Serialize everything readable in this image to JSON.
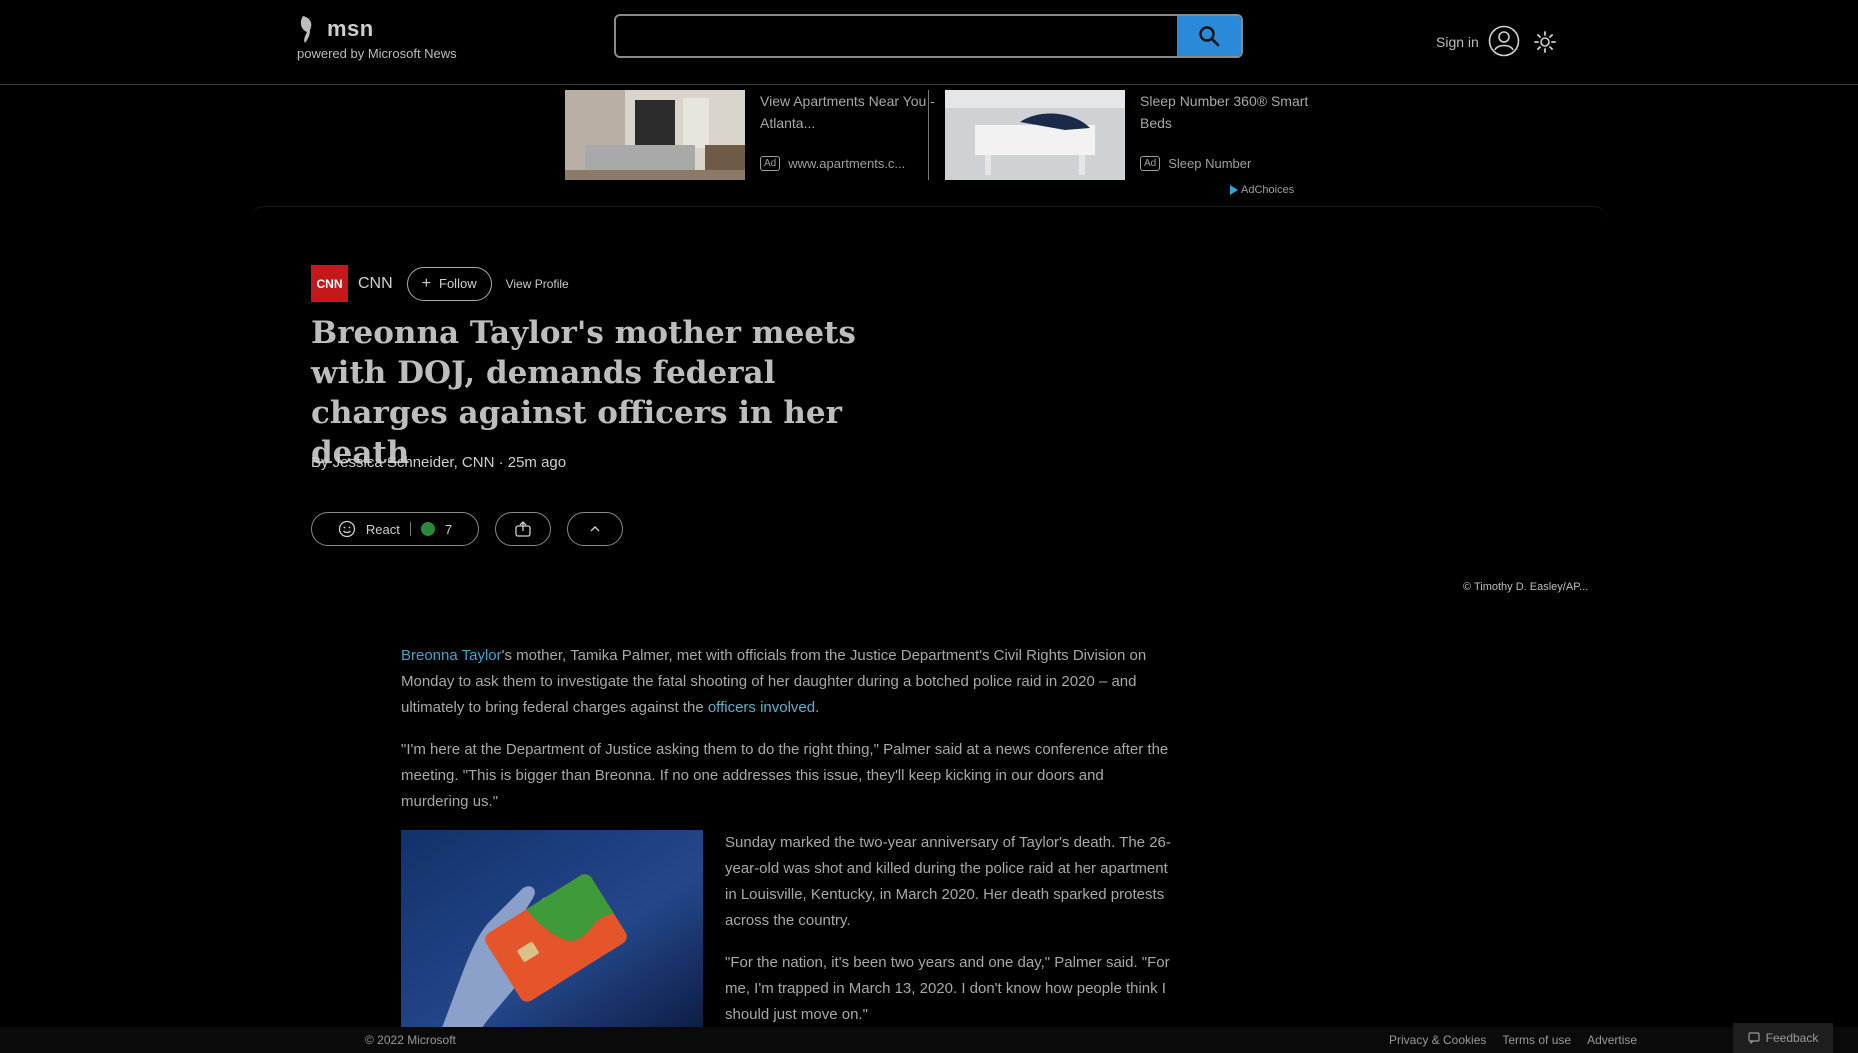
{
  "header": {
    "logo_word": "msn",
    "powered_by": "powered by Microsoft News",
    "search_placeholder": "",
    "sign_in": "Sign in"
  },
  "ads": [
    {
      "title": "View Apartments Near You - Atlanta...",
      "badge": "Ad",
      "source": "www.apartments.c..."
    },
    {
      "title": "Sleep Number 360® Smart Beds",
      "badge": "Ad",
      "source": "Sleep Number"
    }
  ],
  "adchoices": "AdChoices",
  "article": {
    "source_logo": "CNN",
    "source_name": "CNN",
    "follow_label": "Follow",
    "view_profile": "View Profile",
    "headline": "Breonna Taylor's mother meets with DOJ, demands federal charges against officers in her death",
    "byline": "By Jessica Schneider, CNN · 25m ago",
    "react_label": "React",
    "react_count": "7",
    "photo_credit": "© Timothy D. Easley/AP...",
    "p1_link": "Breonna Taylor",
    "p1_text": "'s mother, Tamika Palmer, met with officials from the Justice Department's Civil Rights Division on Monday to ask them to investigate the fatal shooting of her daughter during a botched police raid in 2020 – and ultimately to bring federal charges against the ",
    "p1_link2": "officers involved",
    "p1_end": ".",
    "p2": "\"I'm here at the Department of Justice asking them to do the right thing,\" Palmer said at a news conference after the meeting. \"This is bigger than Breonna. If no one addresses this issue, they'll keep kicking in our doors and murdering us.\"",
    "p3": "Sunday marked the two-year anniversary of Taylor's death. The 26-year-old was shot and killed during the police raid at her apartment in Louisville, Kentucky, in March 2020. Her death sparked protests across the country.",
    "p4": "\"For the nation, it's been two years and one day,\" Palmer said. \"For me, I'm trapped in March 13, 2020. I don't know how people think I should just move on.\""
  },
  "footer": {
    "copyright": "© 2022 Microsoft",
    "links": [
      "Privacy & Cookies",
      "Terms of use",
      "Advertise"
    ],
    "feedback": "Feedback"
  },
  "icons": {
    "search": "search-icon",
    "avatar": "user-avatar-icon",
    "settings": "gear-icon",
    "react": "smiley-icon",
    "share": "share-icon",
    "more": "chevron-up-icon"
  },
  "colors": {
    "search_button": "#2a89d8",
    "cnn_red": "#c4181a",
    "link": "#4aa0c8"
  }
}
